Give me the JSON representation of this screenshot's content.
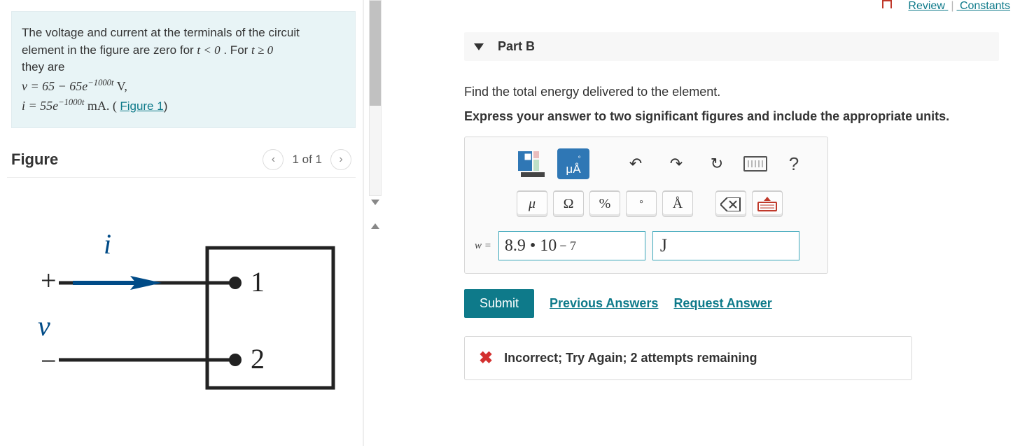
{
  "top_links": {
    "review": "Review",
    "constants": "Constants"
  },
  "problem": {
    "line1": "The voltage and current at the terminals of the circuit",
    "line2_a": "element in the figure are zero for ",
    "line2_b": ". For ",
    "line3": "they are",
    "cond1": "t < 0",
    "cond2": "t ≥ 0",
    "v_expr_a": "v = 65  −  65e",
    "v_expr_exp": "−1000t",
    "v_expr_b": " V,",
    "i_expr_a": "i = 55e",
    "i_expr_exp": "−1000t",
    "i_expr_b": " mA. (",
    "fig_link": "Figure 1",
    "close_paren": ")"
  },
  "figure": {
    "title": "Figure",
    "pager": "1 of 1",
    "labels": {
      "i": "i",
      "plus": "+",
      "v": "v",
      "minus": "−",
      "t1": "1",
      "t2": "2"
    }
  },
  "part": {
    "title": "Part B",
    "prompt": "Find the total energy delivered to the element.",
    "instruction": "Express your answer to two significant figures and include the appropriate units."
  },
  "toolbar": {
    "ua": "μÅ",
    "undo": "↶",
    "redo": "↷",
    "reset": "↻",
    "help": "?"
  },
  "keys": {
    "mu": "μ",
    "omega": "Ω",
    "percent": "%",
    "deg": "°",
    "ang": "Å"
  },
  "answer": {
    "label": "w =",
    "value_mantissa": "8.9 • 10",
    "value_exp": "− 7",
    "unit": "J"
  },
  "actions": {
    "submit": "Submit",
    "previous": "Previous Answers",
    "request": "Request Answer"
  },
  "feedback": {
    "text": "Incorrect; Try Again; 2 attempts remaining"
  }
}
